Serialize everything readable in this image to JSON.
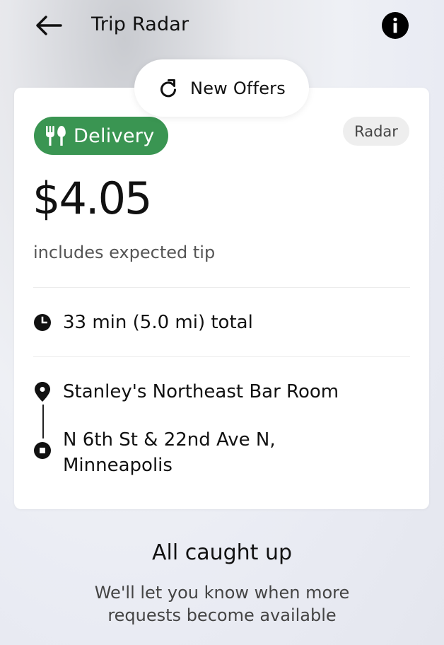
{
  "header": {
    "title": "Trip Radar",
    "back_icon": "arrow-left-icon",
    "info_icon": "info-icon"
  },
  "new_offers": {
    "label": "New Offers",
    "icon": "refresh-icon"
  },
  "offer": {
    "type_label": "Delivery",
    "type_icon": "fork-knife-icon",
    "type_color": "#3a9552",
    "source_label": "Radar",
    "price": "$4.05",
    "price_note": "includes expected tip",
    "duration": "33 min (5.0 mi) total",
    "pickup": "Stanley's Northeast Bar Room",
    "dropoff_line1": "N 6th St & 22nd Ave N,",
    "dropoff_line2": "Minneapolis"
  },
  "empty_state": {
    "title": "All caught up",
    "subtitle_line1": "We'll let you know when more",
    "subtitle_line2": "requests become available"
  }
}
